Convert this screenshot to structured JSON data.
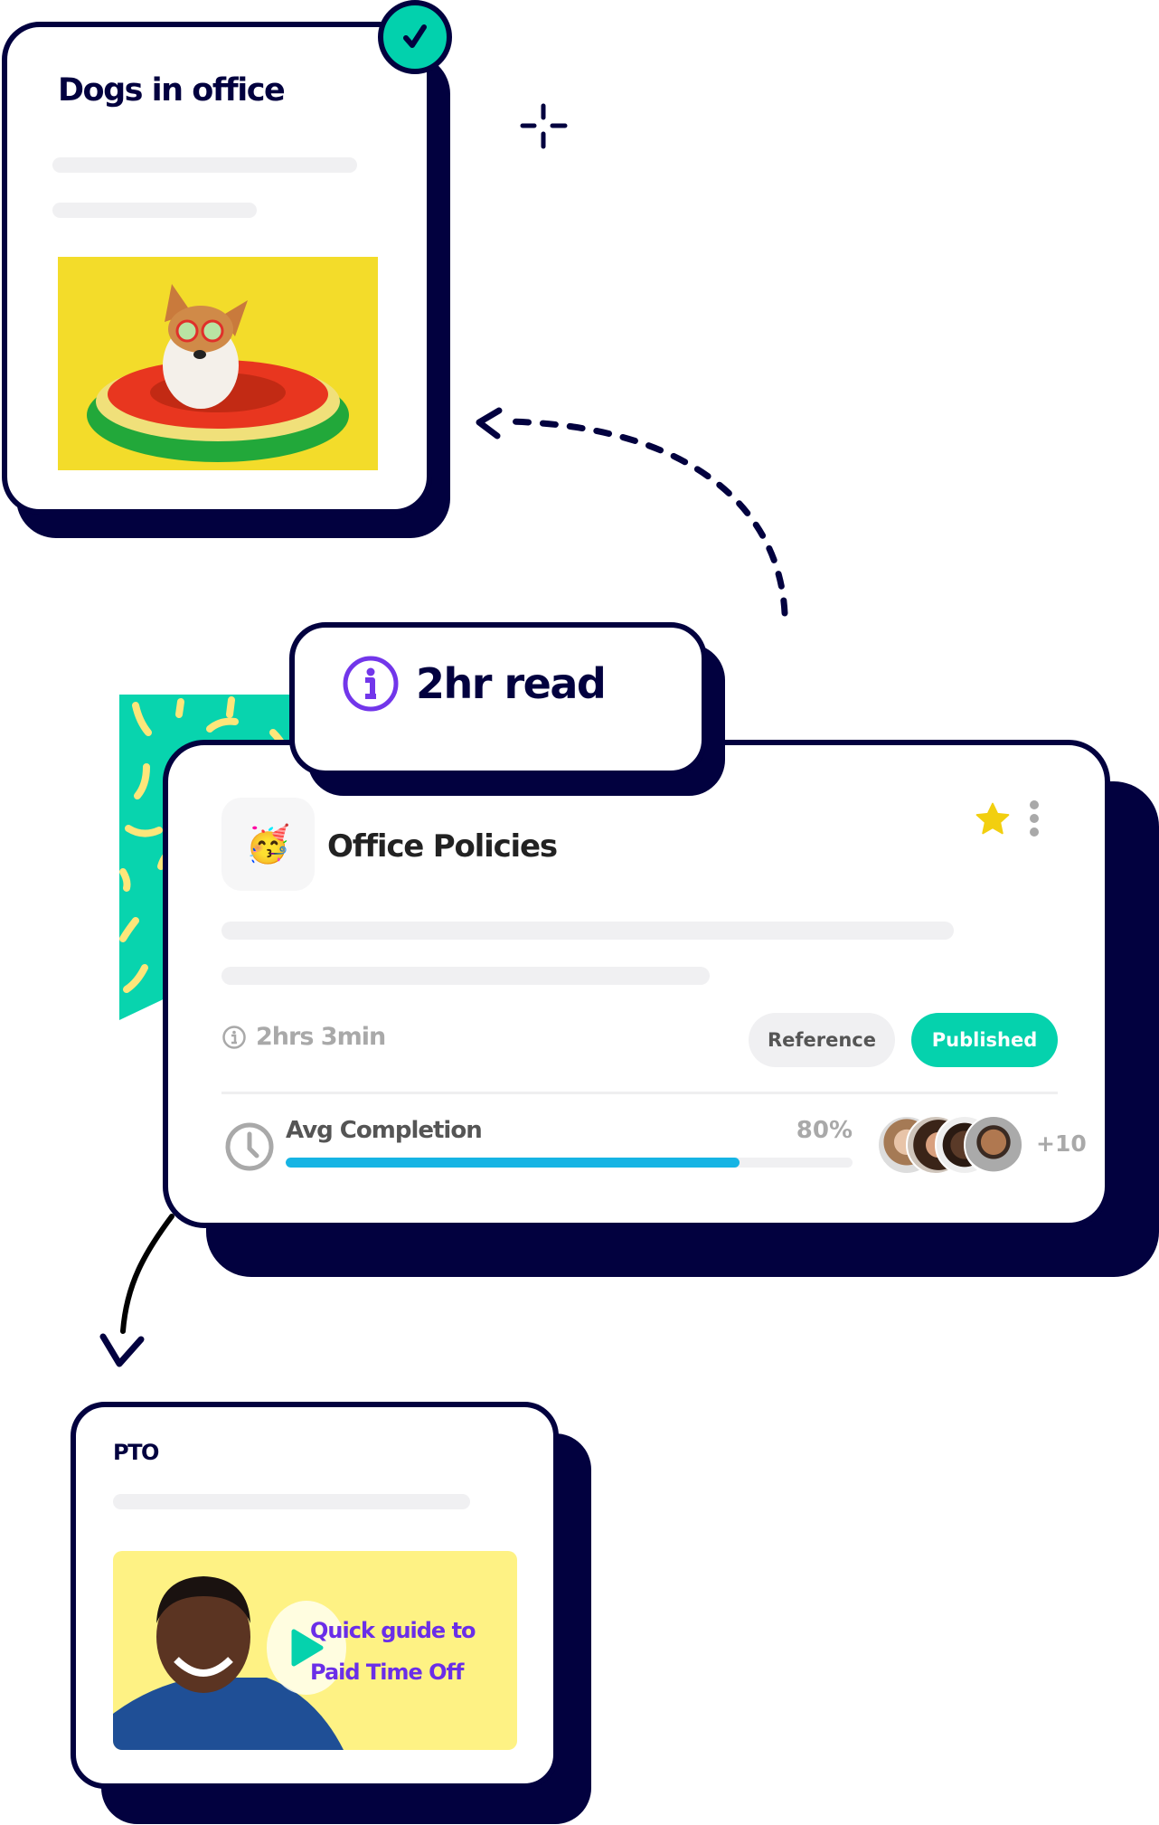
{
  "card_dogs": {
    "title": "Dogs in office",
    "status_icon": "check-icon",
    "image_alt": "corgi-in-watermelon-float-photo"
  },
  "read_badge": {
    "icon": "info-icon",
    "label": "2hr read"
  },
  "office_policies": {
    "emoji": "🥳",
    "title": "Office Policies",
    "favorite_icon": "star-icon",
    "menu_icon": "more-vertical-icon",
    "duration_icon": "info-icon",
    "duration": "2hrs 3min",
    "tags": [
      "Reference",
      "Published"
    ],
    "completion": {
      "icon": "clock-icon",
      "label": "Avg Completion",
      "percent_text": "80%",
      "value": 0.8
    },
    "avatars_extra": "+10"
  },
  "card_pto": {
    "title": "PTO",
    "video": {
      "line1": "Quick guide to",
      "line2": "Paid Time Off",
      "play_icon": "play-icon"
    }
  },
  "colors": {
    "navy": "#02013f",
    "teal": "#05d2ad",
    "purple": "#6a2ee8",
    "progress": "#16b4e4",
    "star": "#f2cf0f",
    "video_bg": "#fef284"
  }
}
